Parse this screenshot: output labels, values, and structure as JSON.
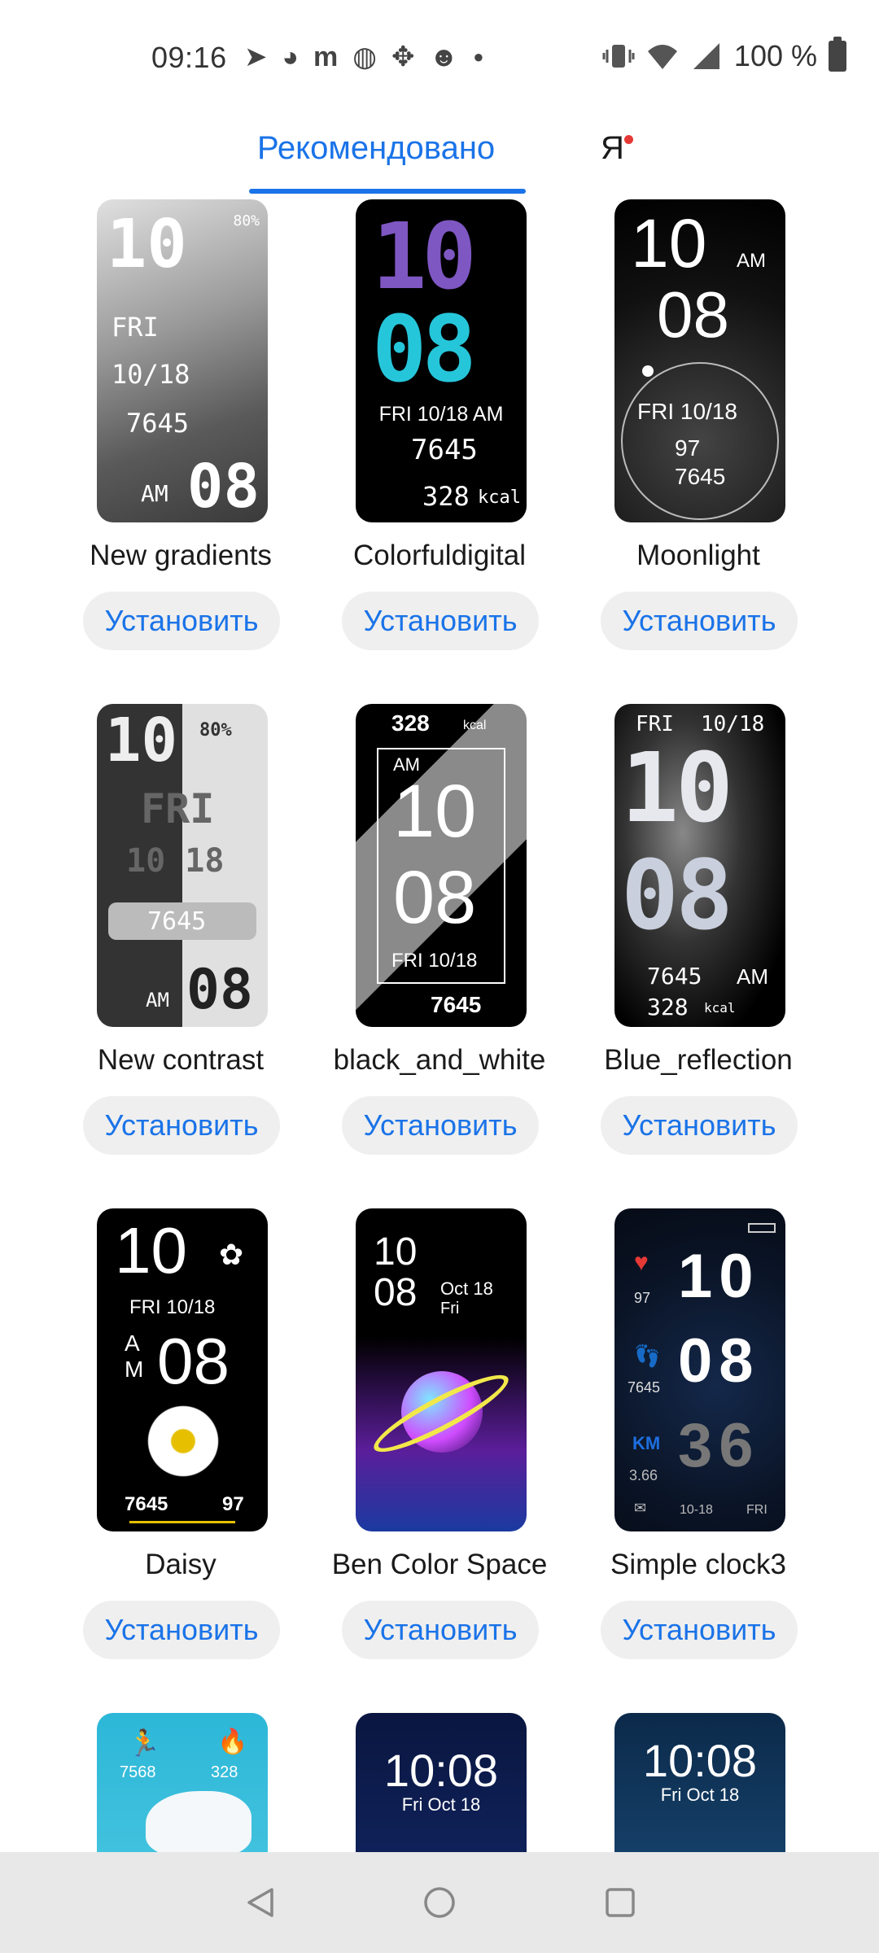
{
  "status_bar": {
    "time": "09:16",
    "battery_text": "100 %",
    "left_icons": [
      "telegram-icon",
      "messenger-icon",
      "m-app-icon",
      "globe-icon",
      "move-icon",
      "emoji-icon",
      "dot-icon"
    ],
    "right_icons": [
      "vibrate-icon",
      "wifi-icon",
      "signal-icon",
      "battery-icon"
    ]
  },
  "tabs": {
    "recommended": "Рекомендовано",
    "me": "Я"
  },
  "install_label": "Установить",
  "cards": [
    {
      "title": "New gradients",
      "face": {
        "hour": "10",
        "min": "08",
        "day": "FRI",
        "date": "10/18",
        "steps": "7645",
        "ampm": "AM",
        "battery": "80%"
      }
    },
    {
      "title": "Colorfuldigital",
      "face": {
        "hour": "10",
        "min": "08",
        "line": "FRI 10/18 AM",
        "steps": "7645",
        "kcal": "328",
        "unit": "kcal"
      }
    },
    {
      "title": "Moonlight",
      "face": {
        "hour": "10",
        "min": "08",
        "ampm": "AM",
        "date": "FRI 10/18",
        "heart": "97",
        "steps": "7645"
      }
    },
    {
      "title": "New contrast",
      "face": {
        "hour": "10",
        "min": "08",
        "day": "FRI",
        "date": "10 18",
        "steps": "7645",
        "ampm": "AM",
        "battery": "80%"
      }
    },
    {
      "title": "black_and_white",
      "face": {
        "hour": "10",
        "min": "08",
        "ampm": "AM",
        "kcal": "328",
        "unit": "kcal",
        "date": "FRI 10/18",
        "steps": "7645"
      }
    },
    {
      "title": "Blue_reflection",
      "face": {
        "hour": "10",
        "min": "08",
        "day": "FRI",
        "date": "10/18",
        "steps": "7645",
        "ampm": "AM",
        "kcal": "328",
        "unit": "kcal"
      }
    },
    {
      "title": "Daisy",
      "face": {
        "hour": "10",
        "min": "08",
        "date": "FRI  10/18",
        "a": "A",
        "m": "M",
        "steps": "7645",
        "heart": "97"
      }
    },
    {
      "title": "Ben Color Space",
      "face": {
        "hour": "10",
        "min": "08",
        "date": "Oct 18",
        "day": "Fri"
      }
    },
    {
      "title": "Simple clock3",
      "face": {
        "hour": "10",
        "min": "08",
        "sec": "36",
        "heart": "97",
        "steps": "7645",
        "km_label": "KM",
        "km": "3.66",
        "date": "10-18",
        "day": "FRI"
      }
    },
    {
      "title": "",
      "face": {
        "steps": "7568",
        "kcal": "328"
      }
    },
    {
      "title": "",
      "face": {
        "time": "10:08",
        "date": "Fri  Oct 18"
      }
    },
    {
      "title": "",
      "face": {
        "time": "10:08",
        "date": "Fri   Oct 18"
      }
    }
  ],
  "colors": {
    "accent": "#1a73e8",
    "notification_dot": "#e53935",
    "button_bg": "#efefef",
    "nav_bg": "#e8e8e8"
  },
  "nav": [
    "back-icon",
    "home-icon",
    "recents-icon"
  ]
}
